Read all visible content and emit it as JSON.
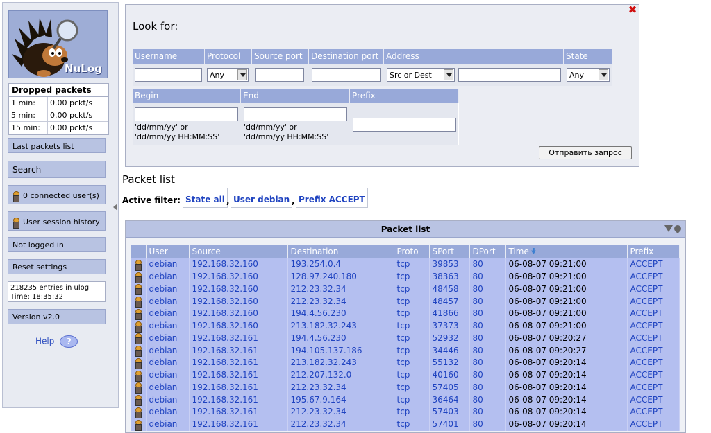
{
  "sidebar": {
    "logo_text": "NuLog",
    "dropped": {
      "title": "Dropped packets",
      "rows": [
        {
          "label": "1 min:",
          "value": "0.00 pckt/s"
        },
        {
          "label": "5 min:",
          "value": "0.00 pckt/s"
        },
        {
          "label": "15 min:",
          "value": "0.00 pckt/s"
        }
      ]
    },
    "last_packets": "Last packets list",
    "search": "Search",
    "connected_users": "0 connected user(s)",
    "session_history": "User session history",
    "not_logged_in": "Not logged in",
    "reset_settings": "Reset settings",
    "entries_line1": "218235 entries in ulog",
    "entries_line2": "Time: 18:35:32",
    "version": "Version v2.0",
    "help": "Help",
    "help_icon_glyph": "?"
  },
  "search_form": {
    "title": "Look for:",
    "headers": {
      "username": "Username",
      "protocol": "Protocol",
      "source_port": "Source port",
      "destination_port": "Destination port",
      "address": "Address",
      "state": "State",
      "begin": "Begin",
      "end": "End",
      "prefix": "Prefix"
    },
    "protocol_value": "Any",
    "address_mode_value": "Src or Dest",
    "state_value": "Any",
    "date_format_line1": "'dd/mm/yy' or",
    "date_format_line2": "'dd/mm/yy HH:MM:SS'",
    "submit": "Отправить запрос",
    "close_glyph": "✖"
  },
  "packet_list": {
    "heading": "Packet list",
    "active_filter_label": "Active filter:",
    "filters": [
      "State all",
      "User debian",
      "Prefix ACCEPT"
    ],
    "panel_title": "Packet list",
    "columns": [
      "User",
      "Source",
      "Destination",
      "Proto",
      "SPort",
      "DPort",
      "Time",
      "Prefix"
    ],
    "rows": [
      [
        "debian",
        "192.168.32.160",
        "193.254.0.4",
        "tcp",
        "39853",
        "80",
        "06-08-07 09:21:00",
        "ACCEPT"
      ],
      [
        "debian",
        "192.168.32.160",
        "128.97.240.180",
        "tcp",
        "38363",
        "80",
        "06-08-07 09:21:00",
        "ACCEPT"
      ],
      [
        "debian",
        "192.168.32.160",
        "212.23.32.34",
        "tcp",
        "48458",
        "80",
        "06-08-07 09:21:00",
        "ACCEPT"
      ],
      [
        "debian",
        "192.168.32.160",
        "212.23.32.34",
        "tcp",
        "48457",
        "80",
        "06-08-07 09:21:00",
        "ACCEPT"
      ],
      [
        "debian",
        "192.168.32.160",
        "194.4.56.230",
        "tcp",
        "41866",
        "80",
        "06-08-07 09:21:00",
        "ACCEPT"
      ],
      [
        "debian",
        "192.168.32.160",
        "213.182.32.243",
        "tcp",
        "37373",
        "80",
        "06-08-07 09:21:00",
        "ACCEPT"
      ],
      [
        "debian",
        "192.168.32.161",
        "194.4.56.230",
        "tcp",
        "52932",
        "80",
        "06-08-07 09:20:27",
        "ACCEPT"
      ],
      [
        "debian",
        "192.168.32.161",
        "194.105.137.186",
        "tcp",
        "34446",
        "80",
        "06-08-07 09:20:27",
        "ACCEPT"
      ],
      [
        "debian",
        "192.168.32.161",
        "213.182.32.243",
        "tcp",
        "55132",
        "80",
        "06-08-07 09:20:14",
        "ACCEPT"
      ],
      [
        "debian",
        "192.168.32.161",
        "212.207.132.0",
        "tcp",
        "40160",
        "80",
        "06-08-07 09:20:14",
        "ACCEPT"
      ],
      [
        "debian",
        "192.168.32.161",
        "212.23.32.34",
        "tcp",
        "57405",
        "80",
        "06-08-07 09:20:14",
        "ACCEPT"
      ],
      [
        "debian",
        "192.168.32.161",
        "195.67.9.164",
        "tcp",
        "36464",
        "80",
        "06-08-07 09:20:14",
        "ACCEPT"
      ],
      [
        "debian",
        "192.168.32.161",
        "212.23.32.34",
        "tcp",
        "57403",
        "80",
        "06-08-07 09:20:14",
        "ACCEPT"
      ],
      [
        "debian",
        "192.168.32.161",
        "212.23.32.34",
        "tcp",
        "57401",
        "80",
        "06-08-07 09:20:14",
        "ACCEPT"
      ]
    ]
  }
}
